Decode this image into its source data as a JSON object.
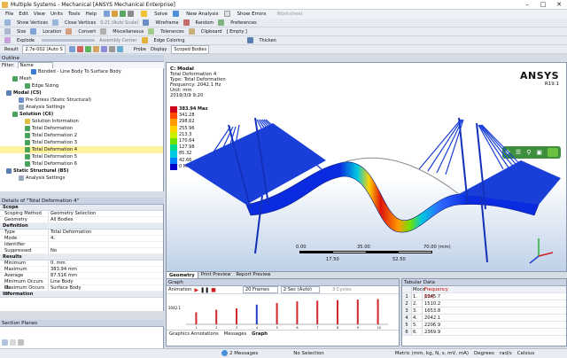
{
  "window": {
    "title": "Multiple Systems - Mechanical [ANSYS Mechanical Enterprise]"
  },
  "menu": [
    "File",
    "Edit",
    "View",
    "Units",
    "Tools",
    "Help"
  ],
  "toolbar1": {
    "solve": "Solve",
    "new_analysis": "New Analysis",
    "show_errors": "Show Errors",
    "worksheet": "Worksheet"
  },
  "toolbar2": {
    "show_vertices": "Show Vertices",
    "close_vertices": "Close Vertices",
    "auto_scale": "0.21 (Auto Scale)",
    "wireframe": "Wireframe",
    "random": "Random",
    "preferences": "Preferences"
  },
  "toolbar3": {
    "size": "Size",
    "location": "Location",
    "convert": "Convert",
    "misc": "Miscellaneous",
    "tolerances": "Tolerances",
    "clipboard": "Clipboard",
    "empty": "[ Empty ]"
  },
  "toolbar4": {
    "explode": "Explode",
    "assembly_center": "Assembly Center",
    "edge_coloring": "Edge Coloring",
    "thicken": "Thicken"
  },
  "result_bar": {
    "result_label": "Result",
    "result_value": "2.7e-002 (Auto S",
    "probe": "Probe",
    "display_label": "Display",
    "display_value": "Scoped Bodies"
  },
  "outline": {
    "title": "Outline",
    "filter_label": "Filter:",
    "filter_value": "Name",
    "items": [
      {
        "label": "Bonded - Line Body To Surface Body",
        "indent": 5,
        "color": "#3a7bd5"
      },
      {
        "label": "Mesh",
        "indent": 2,
        "color": "#4aa35a"
      },
      {
        "label": "Edge Sizing",
        "indent": 4,
        "color": "#4aa35a"
      },
      {
        "label": "Modal (C5)",
        "indent": 1,
        "color": "#5a7fb3",
        "bold": true
      },
      {
        "label": "Pre-Stress (Static Structural)",
        "indent": 3,
        "color": "#6a8fcf"
      },
      {
        "label": "Analysis Settings",
        "indent": 3,
        "color": "#9aa8bb"
      },
      {
        "label": "Solution (C6)",
        "indent": 2,
        "color": "#4aa35a",
        "bold": true
      },
      {
        "label": "Solution Information",
        "indent": 4,
        "color": "#e0c040"
      },
      {
        "label": "Total Deformation",
        "indent": 4,
        "color": "#4aa35a"
      },
      {
        "label": "Total Deformation 2",
        "indent": 4,
        "color": "#4aa35a"
      },
      {
        "label": "Total Deformation 3",
        "indent": 4,
        "color": "#4aa35a"
      },
      {
        "label": "Total Deformation 4",
        "indent": 4,
        "color": "#4aa35a",
        "selected": true
      },
      {
        "label": "Total Deformation 5",
        "indent": 4,
        "color": "#4aa35a"
      },
      {
        "label": "Total Deformation 6",
        "indent": 4,
        "color": "#4aa35a"
      },
      {
        "label": "Static Structural (B5)",
        "indent": 1,
        "color": "#5a7fb3",
        "bold": true
      },
      {
        "label": "Analysis Settings",
        "indent": 3,
        "color": "#9aa8bb"
      }
    ]
  },
  "details": {
    "title": "Details of \"Total Deformation 4\"",
    "groups": [
      {
        "name": "Scope",
        "rows": [
          [
            "Scoping Method",
            "Geometry Selection"
          ],
          [
            "Geometry",
            "All Bodies"
          ]
        ]
      },
      {
        "name": "Definition",
        "rows": [
          [
            "Type",
            "Total Deformation"
          ],
          [
            "Mode",
            "4."
          ],
          [
            "Identifier",
            ""
          ],
          [
            "Suppressed",
            "No"
          ]
        ]
      },
      {
        "name": "Results",
        "rows": [
          [
            "Minimum",
            "0. mm"
          ],
          [
            "Maximum",
            "383.94 mm"
          ],
          [
            "Average",
            "87.516 mm"
          ],
          [
            "Minimum Occurs On",
            "Line Body"
          ],
          [
            "Maximum Occurs On",
            "Surface Body"
          ]
        ]
      },
      {
        "name": "Information",
        "rows": []
      }
    ]
  },
  "section_planes": {
    "title": "Section Planes"
  },
  "viewport": {
    "label_title": "C: Modal",
    "lines": [
      "Total Deformation 4",
      "Type: Total Deformation",
      "Frequency: 2042.1 Hz",
      "Unit: mm",
      "2019/3/9 9:20"
    ],
    "brand": "ANSYS",
    "version": "R19.1",
    "legend": {
      "values": [
        "383.94 Max",
        "341.28",
        "298.62",
        "255.96",
        "213.3",
        "170.64",
        "127.98",
        "85.32",
        "42.66",
        "0 Min"
      ],
      "colors": [
        "#d0021b",
        "#ff4a00",
        "#ff9a00",
        "#ffd200",
        "#c9f000",
        "#6fe000",
        "#00d98a",
        "#00c9e0",
        "#0080ff",
        "#0000c8"
      ]
    },
    "scale": {
      "labels": [
        "0.00",
        "35.00",
        "70.00 (mm)"
      ],
      "mid_labels": [
        "17.50",
        "52.50"
      ]
    }
  },
  "view_tabs": [
    "Geometry",
    "Print Preview",
    "Report Preview"
  ],
  "graph": {
    "title": "Graph",
    "animation": "Animation",
    "frames": "20 Frames",
    "sec": "2 Sec (Auto)",
    "cycles": "3 Cycles",
    "y_tick": "2042.1",
    "bottom_tabs": [
      "Graphics Annotations",
      "Messages",
      "Graph"
    ]
  },
  "chart_data": {
    "type": "bar",
    "categories": [
      "1",
      "2",
      "3",
      "4",
      "5",
      "6",
      "7",
      "8",
      "9",
      "10"
    ],
    "values": [
      1245.7,
      1510.2,
      1653.8,
      2042.1,
      2206.9,
      2369.9,
      2450,
      2510,
      2560,
      2620
    ],
    "title": "",
    "xlabel": "",
    "ylabel": ""
  },
  "tabular": {
    "title": "Tabular Data",
    "headers": [
      "Mode",
      "Frequency [Hz]"
    ],
    "rows": [
      [
        "1.",
        "1245.7"
      ],
      [
        "2.",
        "1510.2"
      ],
      [
        "3.",
        "1653.8"
      ],
      [
        "4.",
        "2042.1"
      ],
      [
        "5.",
        "2206.9"
      ],
      [
        "6.",
        "2369.9"
      ]
    ]
  },
  "status": {
    "messages": "2 Messages",
    "selection": "No Selection",
    "units": "Metric (mm, kg, N, s, mV, mA)",
    "degrees": "Degrees",
    "rads": "rad/s",
    "celsius": "Celsius"
  }
}
